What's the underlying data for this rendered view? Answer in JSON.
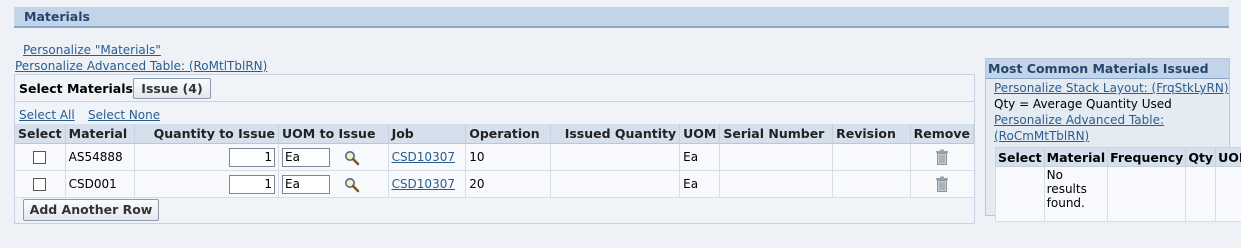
{
  "header": {
    "title": "Materials"
  },
  "links": {
    "personalize_materials": "Personalize \"Materials\"",
    "personalize_table": "Personalize Advanced Table: (RoMtlTblRN)"
  },
  "select_materials": {
    "label": "Select Materials:",
    "issue_button": "Issue (4)",
    "select_all": "Select All",
    "select_none": "Select None"
  },
  "table": {
    "columns": {
      "select": "Select",
      "material": "Material",
      "quantity": "Quantity to Issue",
      "uom_issue": "UOM to Issue",
      "job": "Job",
      "operation": "Operation",
      "issued_qty": "Issued Quantity",
      "uom": "UOM",
      "serial": "Serial Number",
      "revision": "Revision",
      "remove": "Remove"
    },
    "rows": [
      {
        "material": "AS54888",
        "quantity": "1",
        "uom_issue": "Ea",
        "job": "CSD10307",
        "operation": "10",
        "issued_qty": "",
        "uom": "Ea",
        "serial": "",
        "revision": ""
      },
      {
        "material": "CSD001",
        "quantity": "1",
        "uom_issue": "Ea",
        "job": "CSD10307",
        "operation": "20",
        "issued_qty": "",
        "uom": "Ea",
        "serial": "",
        "revision": ""
      }
    ],
    "add_row_button": "Add Another Row"
  },
  "most_common": {
    "title": "Most Common Materials Issued",
    "personalize_stack": "Personalize Stack Layout: (FrqStkLyRN)",
    "note": "Qty = Average Quantity Used",
    "personalize_table_line1": "Personalize Advanced Table:",
    "personalize_table_line2": "(RoCmMtTblRN)",
    "columns": {
      "select": "Select",
      "material": "Material",
      "frequency": "Frequency",
      "qty": "Qty",
      "uom": "UOM"
    },
    "empty_line1": "No",
    "empty_line2": "results",
    "empty_line3": "found."
  },
  "icons": {
    "search": "magnifier-icon",
    "remove": "trash-icon"
  }
}
